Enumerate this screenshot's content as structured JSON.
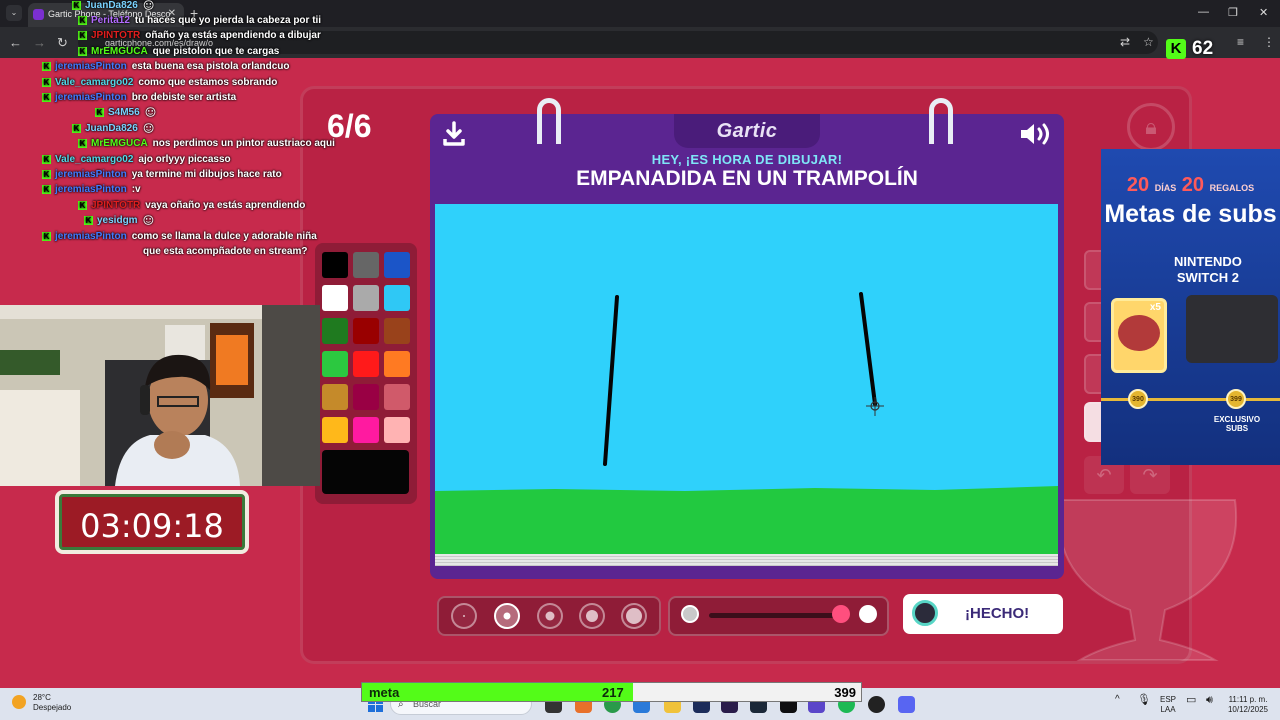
{
  "browser": {
    "tab_title": "Gartic Phone - Teléfono Desco",
    "url": "garticphone.com/es/draw/o"
  },
  "kick": {
    "viewer_count": "62"
  },
  "game": {
    "round": "6/6",
    "logo": "Gartic",
    "prompt_hint": "HEY, ¡ES HORA DE DIBUJAR!",
    "prompt": "EMPANADIDA EN UN TRAMPOLÍN",
    "done_label": "¡HECHO!",
    "selected_brush_size_index": 1,
    "opacity": 1.0,
    "palette": [
      "#000000",
      "#666666",
      "#1b55c8",
      "#ffffff",
      "#aaaaaa",
      "#2fc8f5",
      "#1f7a1f",
      "#990000",
      "#99421b",
      "#2cc840",
      "#ff1a1a",
      "#ff7a22",
      "#c58a2a",
      "#990044",
      "#d05a6a",
      "#ffb81a",
      "#ff1aa0",
      "#ffb3b3"
    ],
    "current_color": "#050505",
    "canvas_bg": "#2fd1fb",
    "grass_color": "#22c940"
  },
  "chat": [
    {
      "user": "JuanDa826",
      "color": "#7ad3ff",
      "text": "",
      "emote": true
    },
    {
      "user": "Perita12",
      "color": "#b36bff",
      "text": "tu haces que yo pierda la cabeza por tii"
    },
    {
      "user": "JPINTOTR",
      "color": "#e01e1e",
      "text": "oñaño ya estás apendiendo a dibujar"
    },
    {
      "user": "MrEMGUCA",
      "color": "#53fc18",
      "text": "que pistolon que te cargas"
    },
    {
      "user": "jeremiasPinton",
      "color": "#3f7bff",
      "text": "esta buena esa pistola orlandcuo"
    },
    {
      "user": "Vale_camargo02",
      "color": "#4fd8e8",
      "text": "como que estamos sobrando"
    },
    {
      "user": "jeremiasPinton",
      "color": "#3f7bff",
      "text": "bro debiste ser artista"
    },
    {
      "user": "S4M56",
      "color": "#7ad3ff",
      "text": "",
      "emote": true
    },
    {
      "user": "JuanDa826",
      "color": "#7ad3ff",
      "text": "",
      "emote": true
    },
    {
      "user": "MrEMGUCA",
      "color": "#53fc18",
      "text": "nos perdimos un pintor austriaco aqui"
    },
    {
      "user": "Vale_camargo02",
      "color": "#4fd8e8",
      "text": "ajo orlyyy piccasso"
    },
    {
      "user": "jeremiasPinton",
      "color": "#3f7bff",
      "text": "ya termine mi dibujos hace rato"
    },
    {
      "user": "jeremiasPinton",
      "color": "#3f7bff",
      "text": ":v"
    },
    {
      "user": "JPINTOTR",
      "color": "#e01e1e",
      "text": "vaya oñaño ya estás aprendiendo"
    },
    {
      "user": "yesidgm",
      "color": "#7ad3ff",
      "text": "",
      "emote": true
    },
    {
      "user": "jeremiasPinton",
      "color": "#3f7bff",
      "text": "como se llama la dulce y adorable niña"
    },
    {
      "user": "",
      "color": "#ffffff",
      "text": "que esta acompñadote en stream?"
    }
  ],
  "timer": "03:09:18",
  "subgoal": {
    "days_num": "20",
    "days_label": "DÍAS",
    "gifts_num": "20",
    "gifts_label": "REGALOS",
    "title": "Metas de subs",
    "prize_line1": "NINTENDO",
    "prize_line2": "SWITCH 2",
    "card_count": "x5",
    "coin_left": "390",
    "coin_right": "399",
    "exclusive": "EXCLUSIVO SUBS"
  },
  "meta_bar": {
    "label": "meta",
    "current": "217",
    "goal": "399",
    "progress": 0.544
  },
  "taskbar": {
    "temperature": "28°C",
    "weather": "Despejado",
    "search_placeholder": "Buscar",
    "lang_line1": "ESP",
    "lang_line2": "LAA",
    "time": "11:11 p. m.",
    "date": "10/12/2025"
  }
}
